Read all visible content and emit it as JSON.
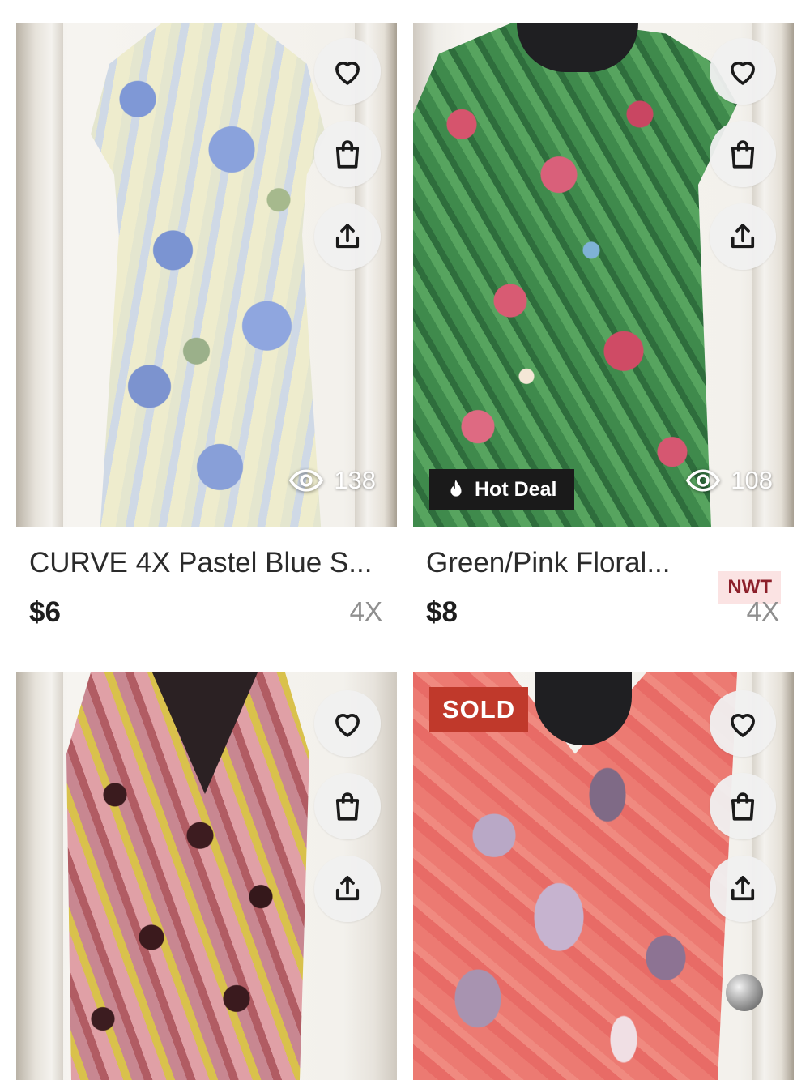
{
  "listings": [
    {
      "title": "CURVE 4X Pastel Blue S...",
      "price": "$6",
      "size": "4X",
      "views": "138",
      "badge": "",
      "tag": "",
      "sold": false
    },
    {
      "title": "Green/Pink Floral...",
      "price": "$8",
      "size": "4X",
      "views": "108",
      "badge": "Hot Deal",
      "tag": "NWT",
      "sold": false
    },
    {
      "title": "",
      "price": "",
      "size": "",
      "views": "",
      "badge": "",
      "tag": "",
      "sold": false
    },
    {
      "title": "",
      "price": "",
      "size": "",
      "views": "",
      "badge": "SOLD",
      "tag": "",
      "sold": true
    }
  ],
  "icons": {
    "like": "heart-icon",
    "bag": "shopping-bag-icon",
    "share": "share-icon",
    "views": "eye-icon",
    "hot": "flame-icon"
  },
  "colors": {
    "sold_badge": "#c0392b",
    "hot_deal_badge": "#1a1a1a",
    "nwt_bg": "#fbe3e3",
    "nwt_text": "#8c1f2a",
    "action_button_bg": "#f0f0f0"
  }
}
